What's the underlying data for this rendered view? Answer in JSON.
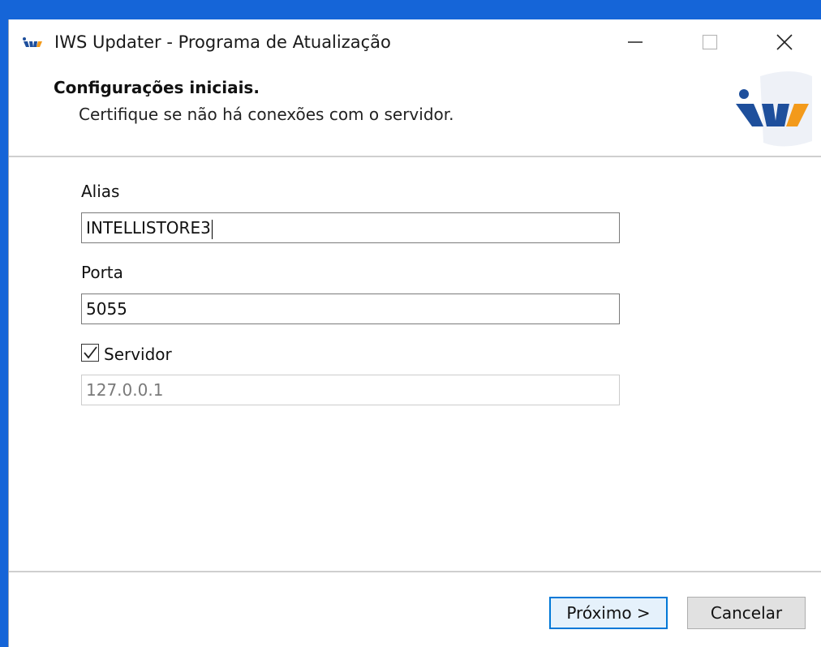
{
  "window": {
    "title": "IWS Updater - Programa de Atualização",
    "controls": {
      "minimize": "minimize-icon",
      "maximize": "maximize-icon",
      "close": "close-icon"
    }
  },
  "header": {
    "title": "Configurações iniciais.",
    "subtitle": "Certifique se não há conexões com o servidor."
  },
  "form": {
    "alias_label": "Alias",
    "alias_value": "INTELLISTORE3",
    "porta_label": "Porta",
    "porta_value": "5055",
    "servidor_label": "Servidor",
    "servidor_checked": true,
    "servidor_value": "127.0.0.1"
  },
  "footer": {
    "next_label": "Próximo >",
    "cancel_label": "Cancelar"
  },
  "colors": {
    "desktop": "#1565d8",
    "accent_blue": "#1e4f9c",
    "accent_orange": "#f39a1b",
    "focus": "#0078d7"
  }
}
